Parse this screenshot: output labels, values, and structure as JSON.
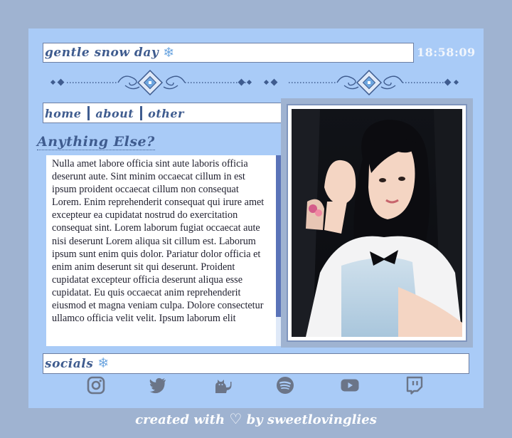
{
  "header": {
    "title": "gentle snow day",
    "title_icon": "snowflake-icon",
    "clock": "18:58:09"
  },
  "nav": {
    "items": [
      {
        "label": "home"
      },
      {
        "label": "about"
      },
      {
        "label": "other"
      }
    ]
  },
  "section": {
    "heading": "Anything Else?",
    "body": "Nulla amet labore officia sint aute laboris officia deserunt aute. Sint minim occaecat cillum in est ipsum proident occaecat cillum non consequat Lorem. Enim reprehenderit consequat qui irure amet excepteur ea cupidatat nostrud do exercitation consequat sint. Lorem laborum fugiat occaecat aute nisi deserunt Lorem aliqua sit cillum est. Laborum ipsum sunt enim quis dolor. Pariatur dolor officia et enim anim deserunt sit qui deserunt. Proident cupidatat excepteur officia deserunt aliqua esse cupidatat. Eu quis occaecat anim reprehenderit eiusmod et magna veniam culpa. Dolore consectetur ullamco officia velit velit. Ipsum laborum elit"
  },
  "photo": {
    "subject": "portrait photo"
  },
  "socials": {
    "label": "socials",
    "label_icon": "snowflake-icon",
    "icons": [
      "instagram-icon",
      "twitter-icon",
      "cat-icon",
      "spotify-icon",
      "youtube-icon",
      "twitch-icon"
    ]
  },
  "footer": {
    "prefix": "created with",
    "heart": "♡",
    "suffix": "by sweetlovinglies"
  },
  "colors": {
    "page_bg": "#9fb3d1",
    "card_bg": "#a9cbf7",
    "accent": "#3f5c8f",
    "scroll_thumb": "#5a73b8"
  }
}
